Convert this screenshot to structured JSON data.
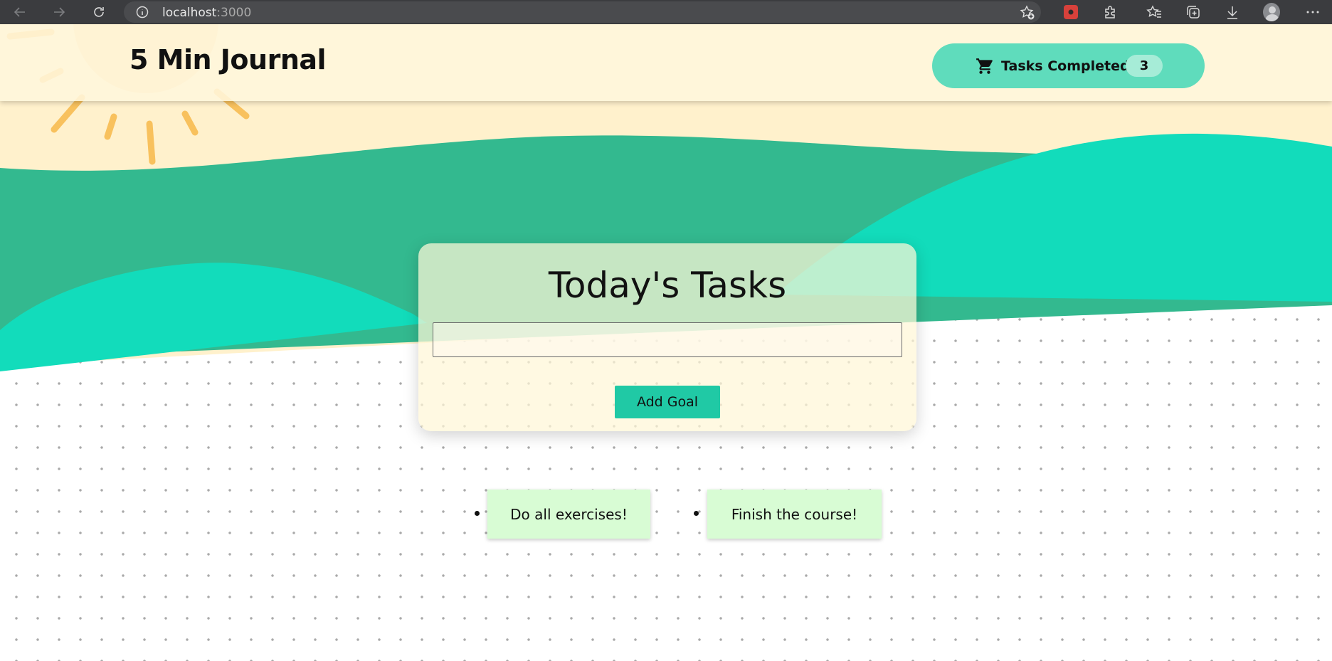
{
  "browser": {
    "url_host": "localhost",
    "url_port": ":3000"
  },
  "header": {
    "brand": "5 Min Journal",
    "tasks_completed_label": "Tasks Completed",
    "tasks_completed_count": "3"
  },
  "card": {
    "title": "Today's Tasks",
    "input_value": "",
    "add_button_label": "Add Goal"
  },
  "goals": [
    "Do all exercises!",
    "Finish the course!"
  ],
  "colors": {
    "header_bg": "#fff6dc",
    "pill_bg": "#5fdcbc",
    "button_bg": "#20c9a5",
    "wave_dark": "#33b98f",
    "wave_bright": "#12dcbb",
    "goal_bg": "#d8fcd4"
  }
}
